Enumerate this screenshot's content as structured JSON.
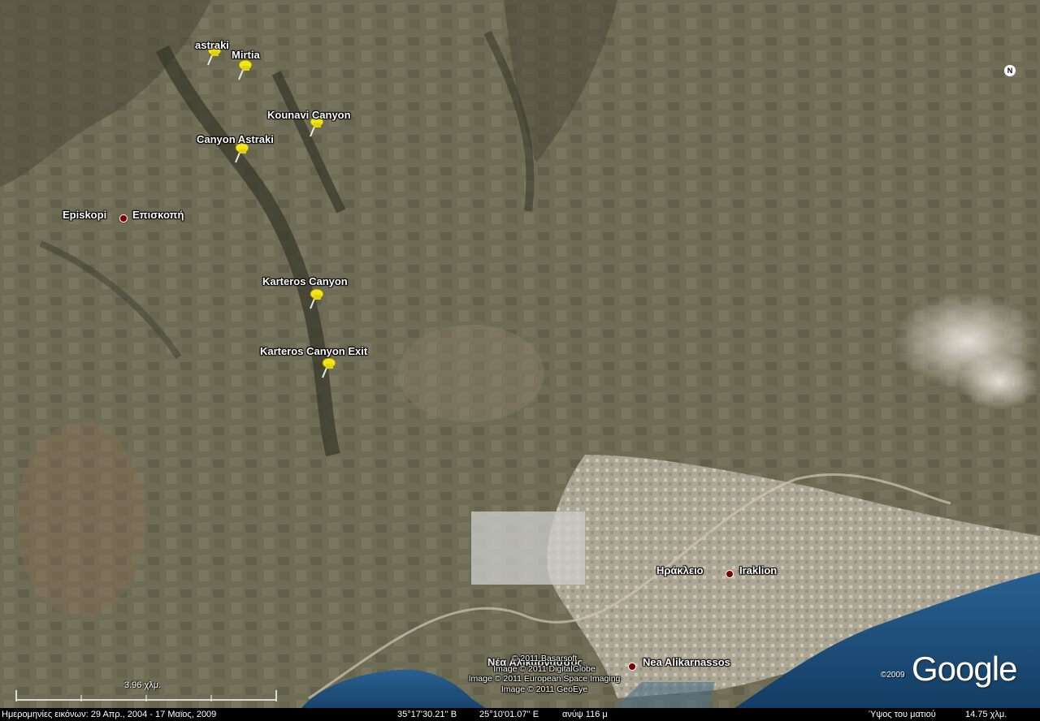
{
  "placemarks": [
    {
      "id": "astraki",
      "label": "astraki"
    },
    {
      "id": "mirtia",
      "label": "Mirtia"
    },
    {
      "id": "kounavi",
      "label": "Kounavi Canyon"
    },
    {
      "id": "canyon-astraki",
      "label": "Canyon Astraki"
    },
    {
      "id": "karteros",
      "label": "Karteros Canyon"
    },
    {
      "id": "karteros-exit",
      "label": "Karteros Canyon Exit"
    }
  ],
  "places": {
    "episkopi": {
      "label_left": "Episkopi",
      "label_right": "Επισκοπή"
    },
    "iraklion": {
      "label_left": "Ηράκλειο",
      "label_right": "Iraklion"
    },
    "nea_alikarnassos": {
      "label_left": "Νέα Αλικαρνασσός",
      "label_right": "Nea Alikarnassos"
    }
  },
  "credits": {
    "line1": "© 2011 Basarsoft",
    "line2": "Image © 2011 DigitalGlobe",
    "line3": "Image © 2011 European Space Imaging",
    "line4": "Image © 2011 GeoEye"
  },
  "logo": {
    "text": "Google",
    "year": "©2009"
  },
  "compass": {
    "letter": "N"
  },
  "scale": {
    "label": "3.96 χλμ."
  },
  "status": {
    "imagery_dates": "Ημερομηνίες εικόνων: 29 Απρ., 2004 - 17 Μαϊος, 2009",
    "latitude": "35°17'30.21'' Β",
    "longitude": "25°10'01.07'' Ε",
    "elevation": "ανύψ  116 μ",
    "eye_alt_label": "Ύψος του ματιού",
    "eye_alt_value": "14.75 χλμ."
  },
  "colors": {
    "pin": "#f2e61a",
    "sea": "#1d4d7a",
    "city": "#b9b3a3",
    "terrain": "#6b6a52",
    "dot": "#7a0000"
  }
}
